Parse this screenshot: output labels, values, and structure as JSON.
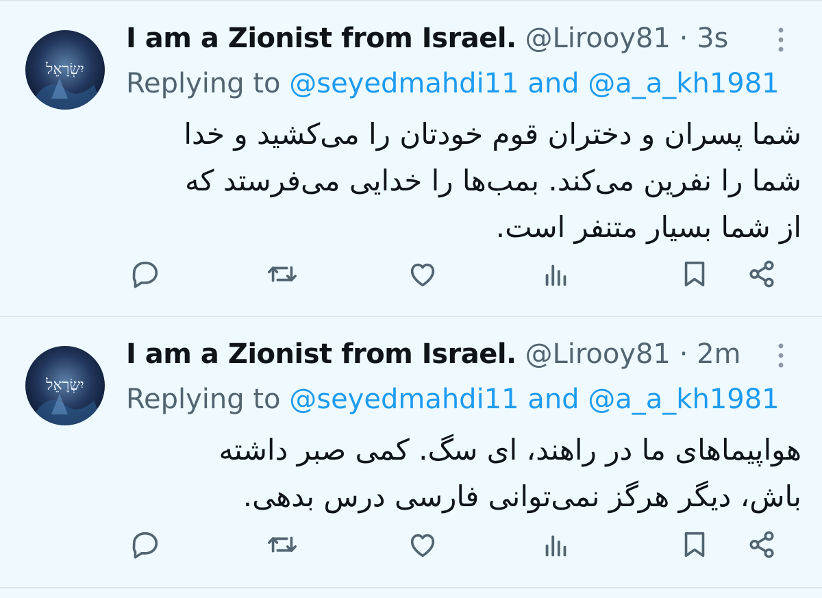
{
  "colors": {
    "background": "#eefaff",
    "text": "#0f1419",
    "secondary": "#536471",
    "link": "#1d9bf0",
    "divider": "#dde6eb"
  },
  "tweets": [
    {
      "avatar_text": "יִשְׂרָאֵל",
      "display_name": "I am a Zionist from Israel.",
      "handle": "@Lirooy81",
      "separator": " · ",
      "time": "3s",
      "reply_prefix": "Replying to ",
      "reply_mention_1": "@seyedmahdi11",
      "reply_and": " and ",
      "reply_mention_2": "@a_a_kh1981",
      "text": "شما پسران و دختران قوم خودتان را می‌کشید و خدا شما را نفرین می‌کند. بمب‌ها را خدایی می‌فرستد که از شما بسیار متنفر است.",
      "actions": [
        "reply-icon",
        "retweet-icon",
        "like-icon",
        "views-icon",
        "bookmark-icon",
        "share-icon"
      ]
    },
    {
      "avatar_text": "יִשְׂרָאֵל",
      "display_name": "I am a Zionist from Israel.",
      "handle": "@Lirooy81",
      "separator": " · ",
      "time": "2m",
      "reply_prefix": "Replying to ",
      "reply_mention_1": "@seyedmahdi11",
      "reply_and": " and ",
      "reply_mention_2": "@a_a_kh1981",
      "text": "هواپیماهای ما در راهند، ای سگ. کمی صبر داشته باش، دیگر هرگز نمی‌توانی فارسی درس بدهی.",
      "actions": [
        "reply-icon",
        "retweet-icon",
        "like-icon",
        "views-icon",
        "bookmark-icon",
        "share-icon"
      ]
    }
  ]
}
